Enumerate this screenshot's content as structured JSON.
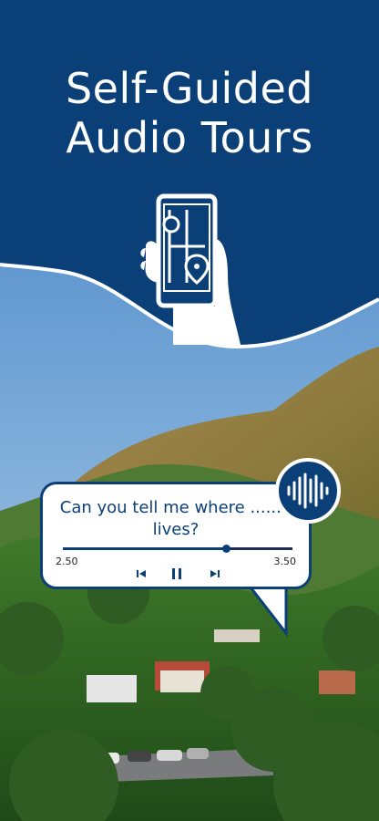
{
  "headline": {
    "line1": "Self-Guided",
    "line2": "Audio Tours"
  },
  "player": {
    "question_line1": "Can you tell me where ........",
    "question_line2": "lives?",
    "time_start": "2.50",
    "time_end": "3.50",
    "progress_fraction": 0.71
  },
  "icons": {
    "phone": "phone-map-icon",
    "prev": "skip-previous-icon",
    "pause": "pause-icon",
    "next": "skip-next-icon",
    "wave": "sound-wave-icon"
  },
  "colors": {
    "brand_blue": "#0b3f78",
    "white": "#ffffff"
  }
}
